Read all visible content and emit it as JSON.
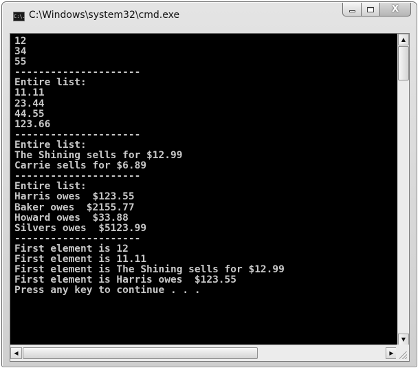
{
  "window": {
    "title": "C:\\Windows\\system32\\cmd.exe",
    "icon_label": "C:\\.",
    "icon": "console-app-icon",
    "controls": {
      "minimize_icon": "minimize-icon",
      "maximize_icon": "maximize-icon",
      "close_glyph": "X"
    }
  },
  "console": {
    "background_color": "#000000",
    "text_color": "#c8c8c8",
    "lines": [
      "12",
      "34",
      "55",
      "---------------------",
      "Entire list:",
      "11.11",
      "23.44",
      "44.55",
      "123.66",
      "---------------------",
      "Entire list:",
      "The Shining sells for $12.99",
      "Carrie sells for $6.89",
      "---------------------",
      "Entire list:",
      "Harris owes  $123.55",
      "Baker owes  $2155.77",
      "Howard owes  $33.88",
      "Silvers owes  $5123.99",
      "---------------------",
      "First element is 12",
      "First element is 11.11",
      "First element is The Shining sells for $12.99",
      "First element is Harris owes  $123.55",
      "Press any key to continue . . ."
    ]
  },
  "scrollbars": {
    "vertical": {
      "up_glyph": "▲",
      "down_glyph": "▼"
    },
    "horizontal": {
      "left_glyph": "◀",
      "right_glyph": "▶"
    }
  }
}
